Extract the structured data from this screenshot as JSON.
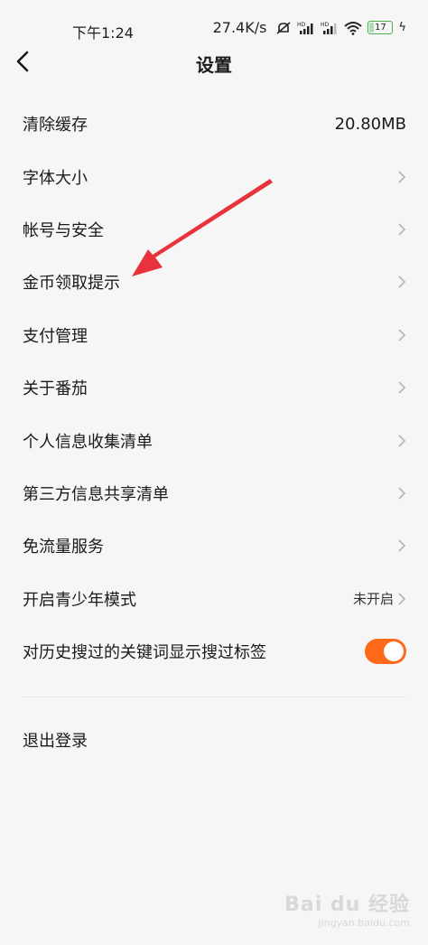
{
  "status_bar": {
    "time": "下午1:24",
    "speed": "27.4K/s",
    "battery": "17",
    "battery_level": 0.17
  },
  "header": {
    "title": "设置"
  },
  "settings": {
    "items": [
      {
        "label": "清除缓存",
        "value": "20.80MB"
      },
      {
        "label": "字体大小"
      },
      {
        "label": "帐号与安全"
      },
      {
        "label": "金币领取提示"
      },
      {
        "label": "支付管理"
      },
      {
        "label": "关于番茄"
      },
      {
        "label": "个人信息收集清单"
      },
      {
        "label": "第三方信息共享清单"
      },
      {
        "label": "免流量服务"
      },
      {
        "label": "开启青少年模式",
        "value": "未开启"
      },
      {
        "label": "对历史搜过的关键词显示搜过标签",
        "toggle": true
      }
    ],
    "logout": "退出登录"
  },
  "colors": {
    "accent": "#ff6a1a",
    "annotation_arrow": "#e8323c",
    "background": "#f6f6f6"
  },
  "watermark": {
    "main": "Bai du 经验",
    "sub": "jingyan.baidu.com"
  }
}
